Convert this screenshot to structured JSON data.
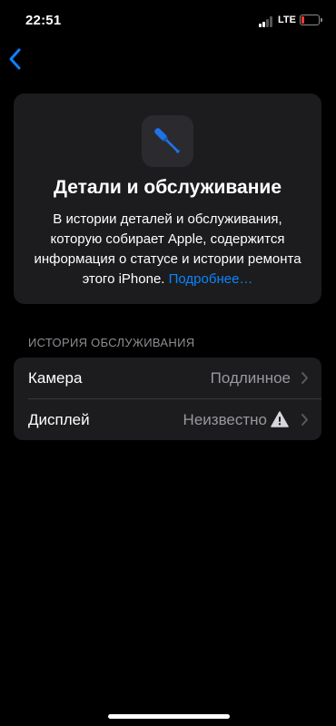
{
  "status": {
    "time": "22:51",
    "network": "LTE"
  },
  "nav": {
    "back_icon": "chevron-left-icon"
  },
  "card": {
    "icon": "screwdriver-icon",
    "title": "Детали и обслуживание",
    "description": "В истории деталей и обслуживания, которую собирает Apple, содержится информация о статусе и истории ремонта этого iPhone.",
    "link": "Подробнее…"
  },
  "history": {
    "header": "ИСТОРИЯ ОБСЛУЖИВАНИЯ",
    "rows": [
      {
        "label": "Камера",
        "value": "Подлинное"
      },
      {
        "label": "Дисплей",
        "value": "Неизвестно",
        "status_icon": "warning-icon"
      }
    ]
  },
  "colors": {
    "accent": "#0a84ff",
    "battery_low": "#ff3b30",
    "card_bg": "#1c1c1e"
  }
}
